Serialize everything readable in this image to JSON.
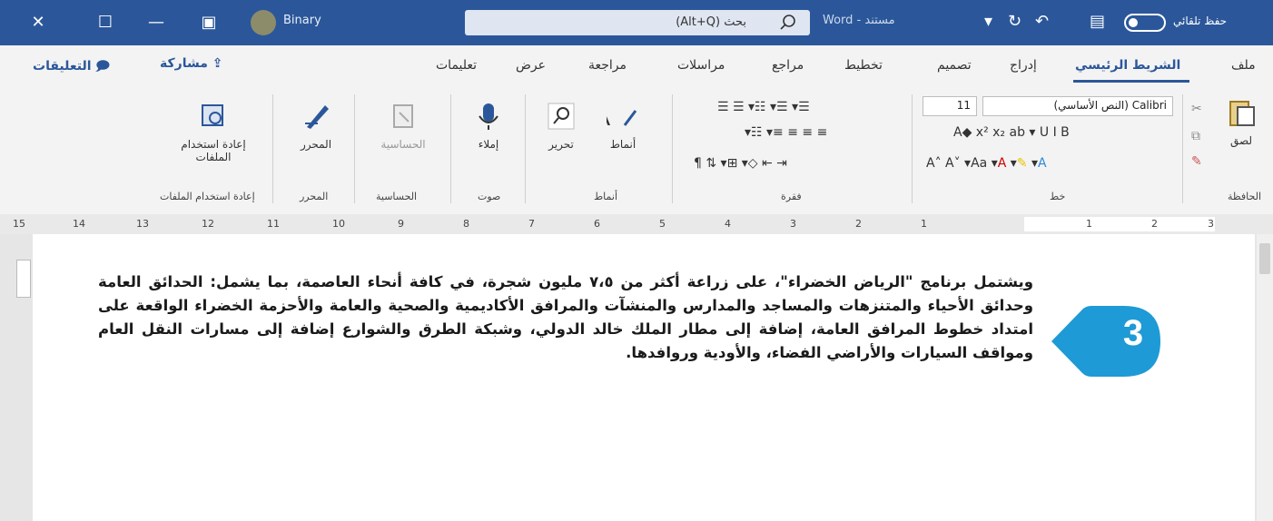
{
  "title_bar": {
    "avatar_label": "Binary",
    "search_text": "بحث (Alt+Q)",
    "doc_name": "مستند - Word",
    "autosave_label": "حفظ تلقائي",
    "icons": [
      "close-icon",
      "maximize-icon",
      "minimize-icon",
      "ribbon-display-icon",
      "search-icon",
      "redo-icon",
      "undo-icon",
      "save-icon",
      "toggle-icon"
    ],
    "accent_color": "#2b579a"
  },
  "tabs": [
    {
      "label": "ملف"
    },
    {
      "label": "الشريط الرئيسي",
      "active": true
    },
    {
      "label": "إدراج"
    },
    {
      "label": "تصميم"
    },
    {
      "label": "تخطيط"
    },
    {
      "label": "مراجع"
    },
    {
      "label": "مراسلات"
    },
    {
      "label": "مراجعة"
    },
    {
      "label": "عرض"
    },
    {
      "label": "تعليمات"
    }
  ],
  "actions": {
    "share": "مشاركة",
    "comments": "التعليقات"
  },
  "ribbon": {
    "paste": "لصق",
    "font_name": "Calibri (النص الأساسي)",
    "font_size": "11",
    "styles": "أنماط",
    "editing": "تحرير",
    "dictate": "إملاء",
    "sensitivity": "الحساسية",
    "editor": "المحرر",
    "reuse_files": "إعادة استخدام الملفات",
    "groups": {
      "clipboard": "الحافظة",
      "font": "خط",
      "paragraph": "فقرة",
      "styles": "أنماط",
      "voice": "صوت",
      "sensitivity": "الحساسية",
      "editor": "المحرر",
      "reuse": "إعادة استخدام الملفات"
    }
  },
  "ruler": {
    "numbers": [
      "15",
      "14",
      "13",
      "12",
      "11",
      "10",
      "9",
      "8",
      "7",
      "6",
      "5",
      "4",
      "3",
      "2",
      "1",
      "1",
      "2",
      "3"
    ]
  },
  "document": {
    "paragraph": "ويشتمل برنامج \"الرياض الخضراء\"، على زراعة أكثر من ٧،٥ مليون شجرة، في كافة أنحاء العاصمة، بما يشمل: الحدائق العامة وحدائق الأحياء والمتنزهات والمساجد والمدارس والمنشآت والمرافق الأكاديمية والصحية والعامة والأحزمة الخضراء الواقعة على امتداد خطوط المرافق العامة، إضافة إلى مطار الملك خالد الدولي، وشبكة الطرق والشوارع إضافة إلى مسارات النقل العام ومواقف السيارات والأراضي الفضاء، والأودية وروافدها.",
    "step_badge": "3",
    "badge_color": "#1e9ad6"
  }
}
